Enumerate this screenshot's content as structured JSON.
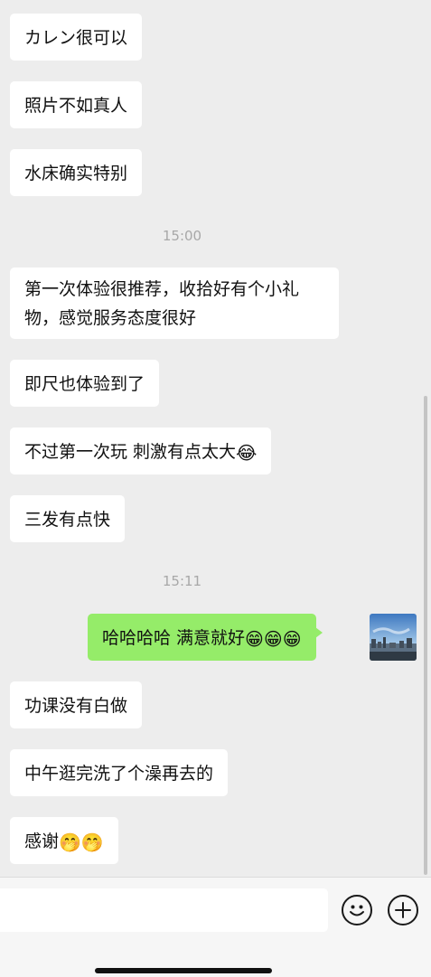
{
  "messages": [
    {
      "text": "カレン很可以"
    },
    {
      "text": "照片不如真人"
    },
    {
      "text": "水床确实特别"
    },
    {
      "text": "第一次体验很推荐，收拾好有个小礼物，感觉服务态度很好"
    },
    {
      "text": "即尺也体验到了"
    },
    {
      "text": "不过第一次玩 刺激有点太大",
      "emoji": "😂"
    },
    {
      "text": "三发有点快"
    },
    {
      "text": "哈哈哈哈 满意就好",
      "emoji": "😁😁😁"
    },
    {
      "text": "功课没有白做"
    },
    {
      "text": "中午逛完洗了个澡再去的"
    },
    {
      "text": "感谢",
      "emoji": "🤭🤭"
    }
  ],
  "timestamps": [
    "15:00",
    "15:11"
  ],
  "input_bar": {
    "emoji_icon": "smiley-face-icon",
    "add_icon": "plus-icon"
  }
}
